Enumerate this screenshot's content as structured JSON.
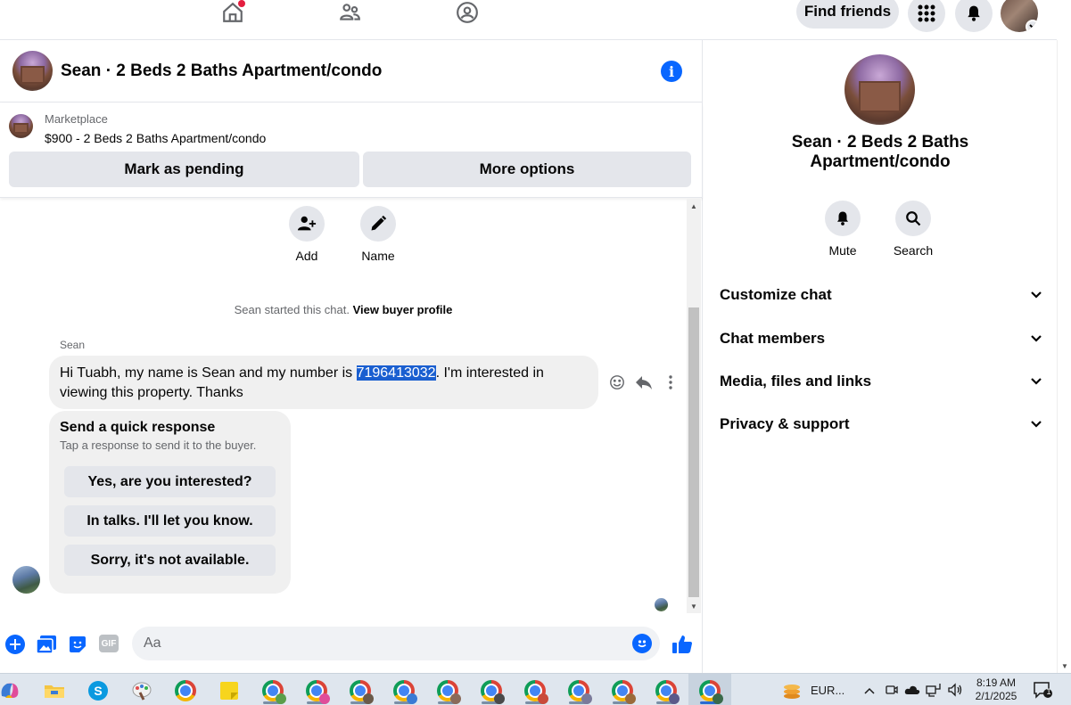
{
  "topnav": {
    "find_friends_label": "Find friends"
  },
  "chat": {
    "title": "Sean · 2 Beds 2 Baths Apartment/condo",
    "listing": {
      "source": "Marketplace",
      "price_title": "$900 - 2 Beds 2 Baths Apartment/condo",
      "mark_pending_label": "Mark as pending",
      "more_options_label": "More options"
    },
    "quick_actions": [
      {
        "label": "Add",
        "icon": "add-person-icon"
      },
      {
        "label": "Name",
        "icon": "pencil-icon"
      }
    ],
    "started_text": "Sean started this chat.",
    "view_buyer_profile": "View buyer profile",
    "message": {
      "sender": "Sean",
      "text_before": "Hi Tuabh, my name is Sean and my number is ",
      "highlighted": "7196413032",
      "text_after": ".  I'm interested in viewing this property.  Thanks"
    },
    "quick_response": {
      "title": "Send a quick response",
      "subtitle": "Tap a response to send it to the buyer.",
      "options": [
        "Yes, are you interested?",
        "In talks. I'll let you know.",
        "Sorry, it's not available."
      ]
    },
    "composer": {
      "placeholder": "Aa",
      "gif_label": "GIF"
    }
  },
  "details": {
    "title": "Sean · 2 Beds 2 Baths Apartment/condo",
    "actions": [
      {
        "label": "Mute",
        "icon": "bell-icon"
      },
      {
        "label": "Search",
        "icon": "search-icon"
      }
    ],
    "sections": [
      "Customize chat",
      "Chat members",
      "Media, files and links",
      "Privacy & support"
    ]
  },
  "taskbar": {
    "tray_label": "EUR...",
    "time": "8:19 AM",
    "date": "2/1/2025",
    "notification_count": "1"
  },
  "colors": {
    "accent": "#0866ff",
    "button_bg": "#e4e6eb",
    "bubble_bg": "#f0f0f0",
    "highlight": "#1a5fd0",
    "notification_red": "#e41e3f"
  }
}
